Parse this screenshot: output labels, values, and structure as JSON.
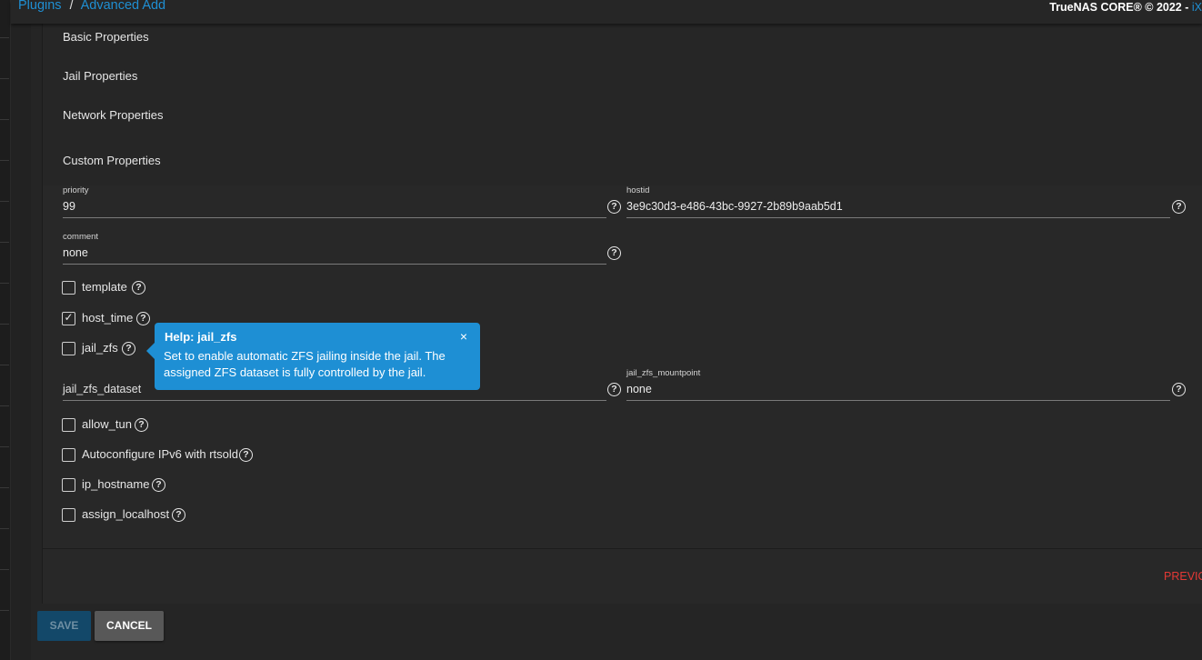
{
  "breadcrumb": {
    "parent": "Plugins",
    "separator": "/",
    "current": "Advanced Add"
  },
  "copyright": {
    "text": "TrueNAS CORE® © 2022 - ",
    "brand": "iX"
  },
  "steps": [
    "Basic Properties",
    "Jail Properties",
    "Network Properties",
    "Custom Properties"
  ],
  "fields": {
    "priority": {
      "label": "priority",
      "value": "99"
    },
    "hostid": {
      "label": "hostid",
      "value": "3e9c30d3-e486-43bc-9927-2b89b9aab5d1"
    },
    "comment": {
      "label": "comment",
      "value": "none"
    },
    "jail_zfs_dataset": {
      "placeholder": "jail_zfs_dataset"
    },
    "jail_zfs_mountpoint": {
      "label": "jail_zfs_mountpoint",
      "value": "none"
    }
  },
  "checkboxes": {
    "template": {
      "label": "template",
      "checked": false
    },
    "host_time": {
      "label": "host_time",
      "checked": true
    },
    "jail_zfs": {
      "label": "jail_zfs",
      "checked": false
    },
    "allow_tun": {
      "label": "allow_tun",
      "checked": false
    },
    "autoconfigure_ipv6": {
      "label": "Autoconfigure IPv6 with rtsold",
      "checked": false
    },
    "ip_hostname": {
      "label": "ip_hostname",
      "checked": false
    },
    "assign_localhost": {
      "label": "assign_localhost",
      "checked": false
    }
  },
  "tooltip": {
    "title": "Help: jail_zfs",
    "body": "Set to enable automatic ZFS jailing inside the jail. The assigned ZFS dataset is fully controlled by the jail.",
    "close": "×"
  },
  "icons": {
    "help": "?",
    "check": "✓"
  },
  "buttons": {
    "previous": "PREVIO",
    "save": "SAVE",
    "cancel": "CANCEL"
  },
  "colors": {
    "accent": "#1f8fd3",
    "tooltip": "#1e8fd4",
    "danger": "#e53935",
    "save_disabled": "#134869"
  }
}
